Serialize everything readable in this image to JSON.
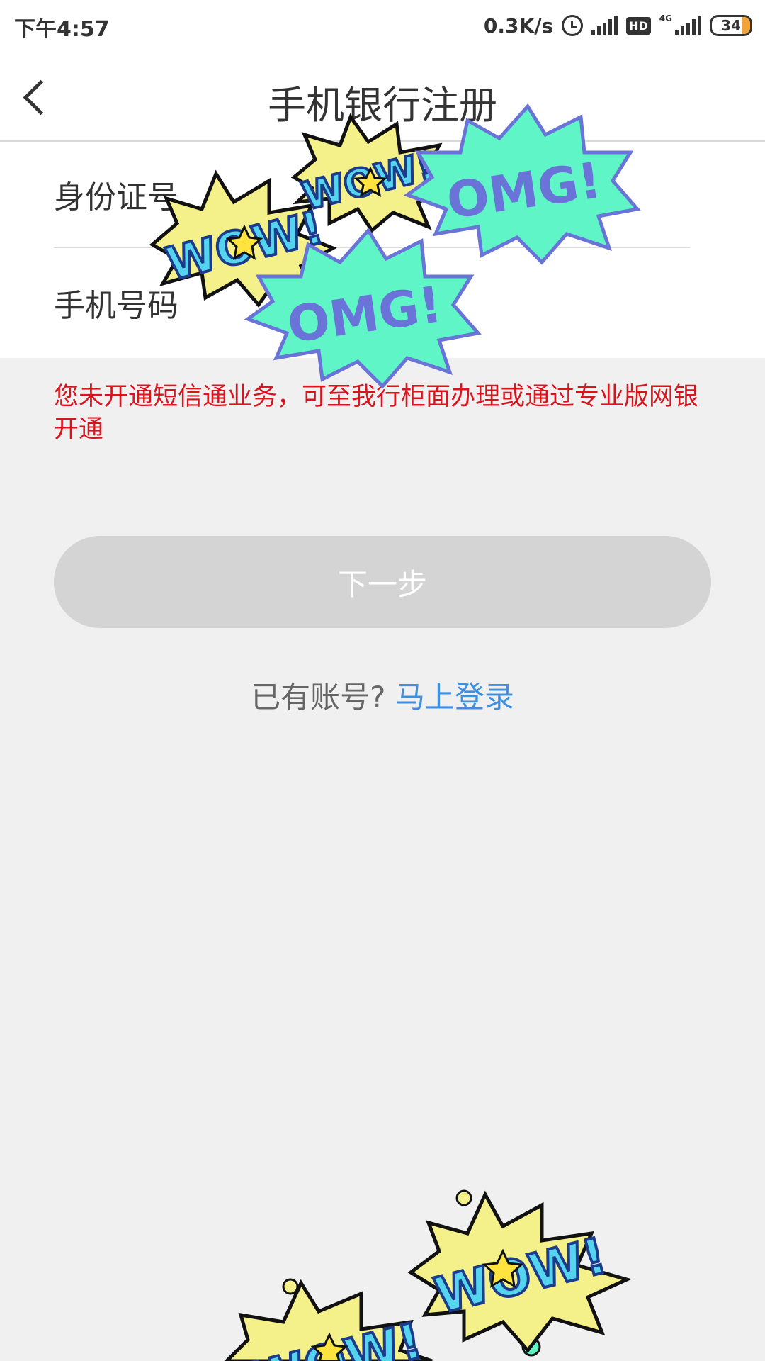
{
  "status_bar": {
    "time": "下午4:57",
    "net_speed": "0.3K/s",
    "hd_badge": "HD",
    "network_type": "4G",
    "battery": "34"
  },
  "nav": {
    "title": "手机银行注册"
  },
  "form": {
    "id_label": "身份证号",
    "phone_label": "手机号码"
  },
  "warning": "您未开通短信通业务，可至我行柜面办理或通过专业版网银开通",
  "next_button": "下一步",
  "login": {
    "question": "已有账号?",
    "link": "马上登录"
  },
  "stickers": {
    "wow": "WOW!",
    "omg": "OMG!"
  },
  "colors": {
    "warning": "#d9141c",
    "link": "#3f8fe0",
    "button_disabled": "#d4d4d4",
    "omg_fill": "#5ff5c6",
    "omg_text": "#6a74d8",
    "wow_fill": "#f4f08a",
    "wow_text": "#55d4f0"
  }
}
